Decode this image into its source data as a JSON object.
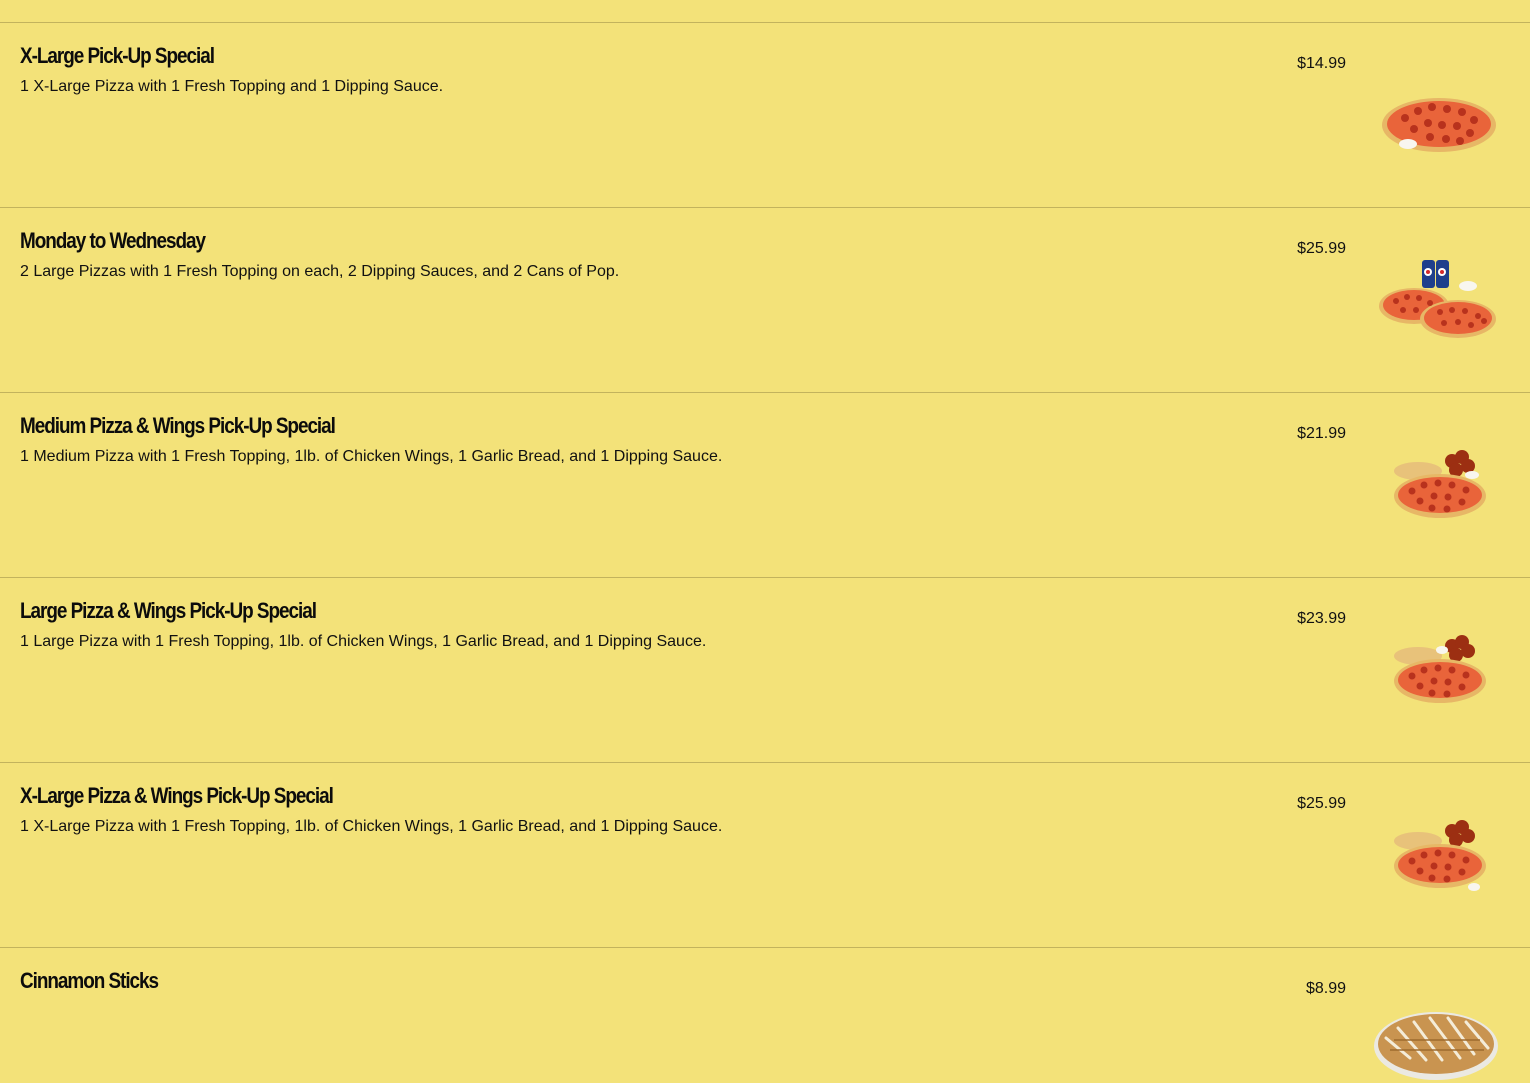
{
  "menu": {
    "items": [
      {
        "name": "X-Large Pick-Up Special",
        "description": "1 X-Large Pizza with 1 Fresh Topping and 1 Dipping Sauce.",
        "price": "$14.99",
        "photo_icon": "xlarge-pizza-dip-photo"
      },
      {
        "name": "Monday to Wednesday",
        "description": "2 Large Pizzas with 1 Fresh Topping on each, 2 Dipping Sauces, and 2 Cans of Pop.",
        "price": "$25.99",
        "photo_icon": "two-pizzas-pop-photo"
      },
      {
        "name": "Medium Pizza & Wings Pick-Up Special",
        "description": "1 Medium Pizza with 1 Fresh Topping, 1lb. of Chicken Wings, 1 Garlic Bread, and 1 Dipping Sauce.",
        "price": "$21.99",
        "photo_icon": "pizza-wings-bread-photo"
      },
      {
        "name": "Large Pizza & Wings Pick-Up Special",
        "description": "1 Large Pizza with 1 Fresh Topping, 1lb. of Chicken Wings, 1 Garlic Bread, and 1 Dipping Sauce.",
        "price": "$23.99",
        "photo_icon": "pizza-wings-bread-photo"
      },
      {
        "name": "X-Large Pizza & Wings Pick-Up Special",
        "description": "1 X-Large Pizza with 1 Fresh Topping, 1lb. of Chicken Wings, 1 Garlic Bread, and 1 Dipping Sauce.",
        "price": "$25.99",
        "photo_icon": "pizza-wings-bread-photo"
      },
      {
        "name": "Cinnamon Sticks",
        "description": "",
        "price": "$8.99",
        "photo_icon": "cinnamon-sticks-photo"
      }
    ]
  },
  "colors": {
    "background": "#f3e279",
    "divider": "#c2b35d",
    "text": "#111111",
    "crust": "#e7b766",
    "sauce": "#e9643a",
    "pepperoni": "#b8321d",
    "wings": "#9c2f12",
    "pop_can": "#1f3f8c"
  }
}
